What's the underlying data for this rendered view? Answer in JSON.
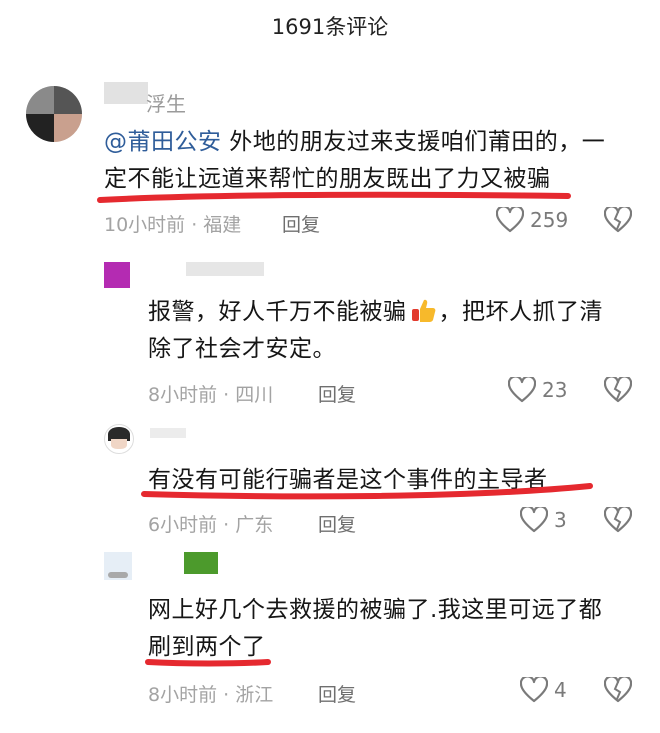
{
  "header": {
    "title": "1691条评论"
  },
  "comments": [
    {
      "username": "浮生",
      "mention": "@莆田公安",
      "text_line1": " 外地的朋友过来支援咱们莆田的，一",
      "text_line2": "定不能让远道来帮忙的朋友既出了力又被骗",
      "meta": "10小时前 · 福建",
      "reply_label": "回复",
      "likes": "259"
    },
    {
      "username": "",
      "text_line1a": "报警，好人千万不能被骗",
      "text_line1b": "，把坏人抓了清",
      "text_line2": "除了社会才安定。",
      "meta": "8小时前 · 四川",
      "reply_label": "回复",
      "likes": "23"
    },
    {
      "username": "",
      "text_line1": "有没有可能行骗者是这个事件的主导者",
      "meta": "6小时前 · 广东",
      "reply_label": "回复",
      "likes": "3"
    },
    {
      "username": "",
      "text_line1": "网上好几个去救援的被骗了.我这里可远了都",
      "text_line2": "刷到两个了",
      "meta": "8小时前 · 浙江",
      "reply_label": "回复",
      "likes": "4"
    }
  ],
  "colors": {
    "underline": "#e5292f",
    "mention": "#2f5d9a"
  }
}
